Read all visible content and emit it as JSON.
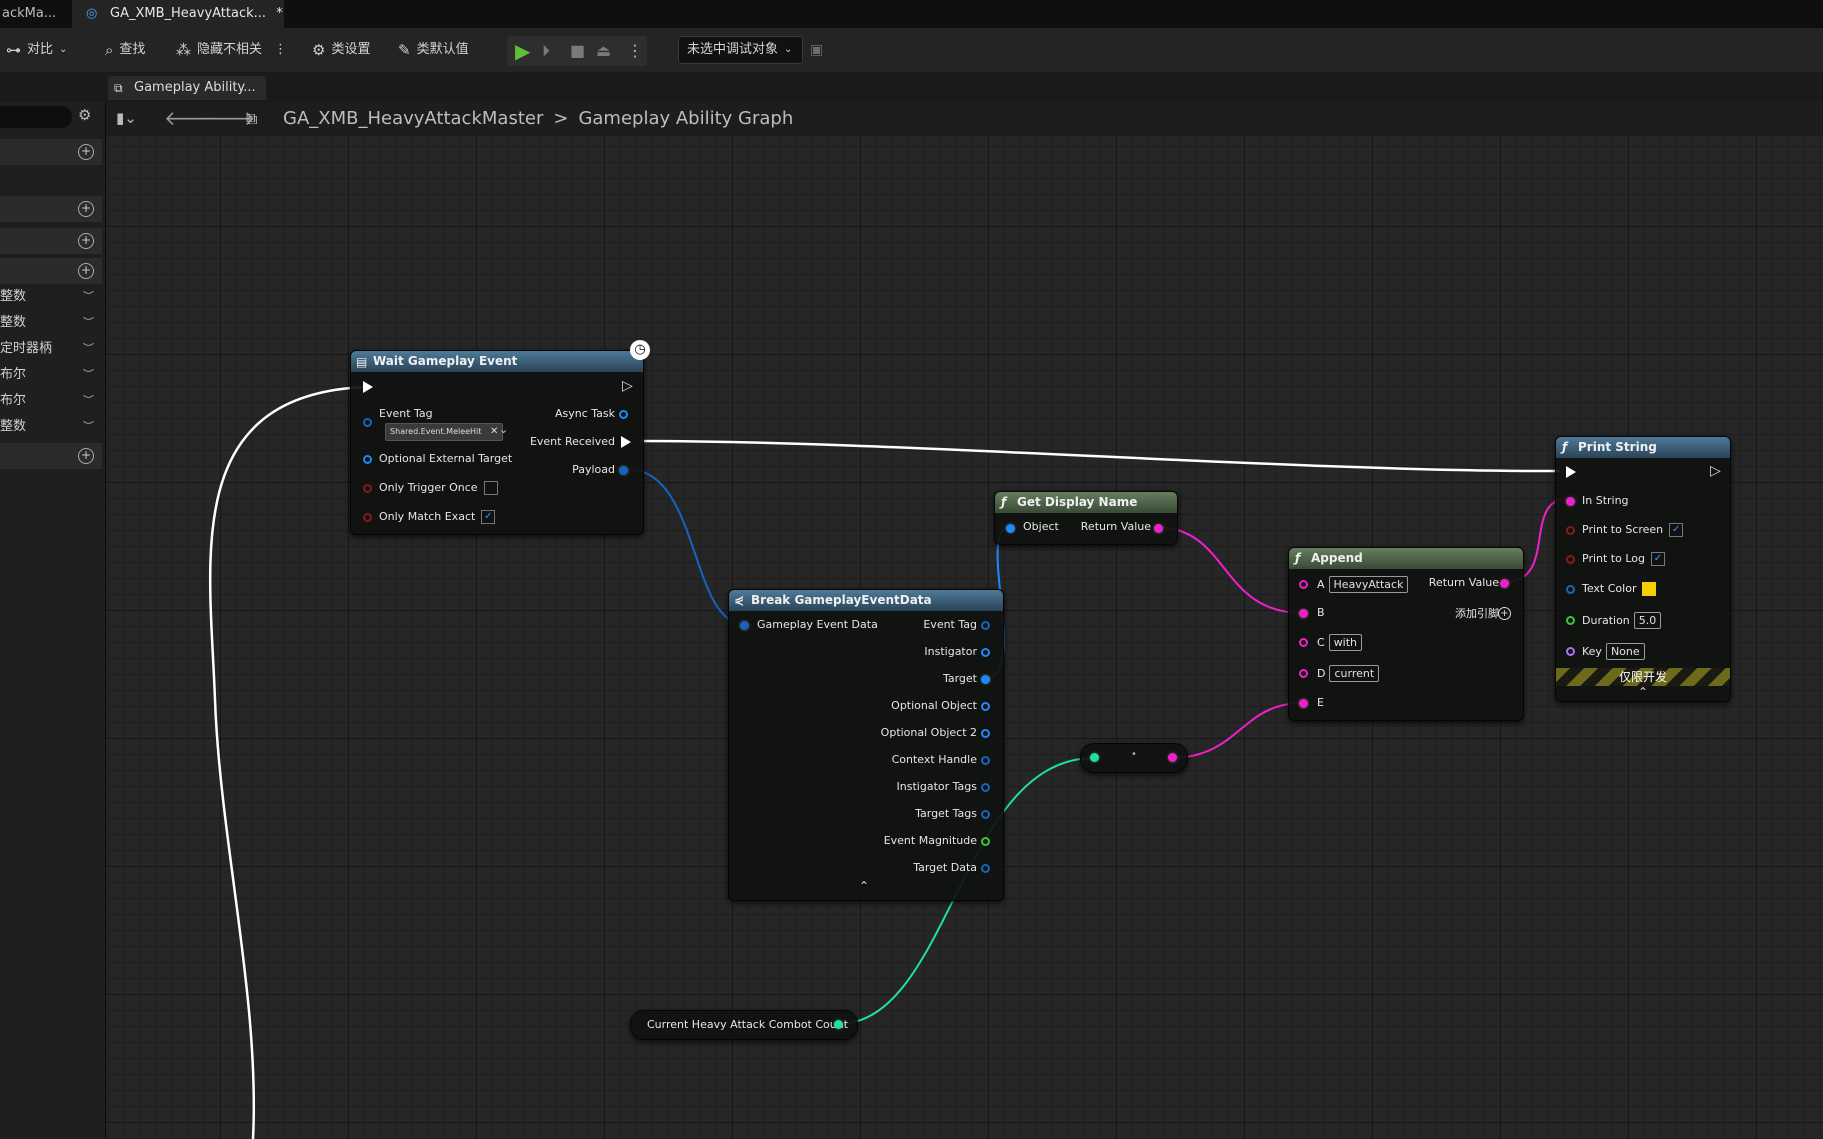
{
  "tabs": {
    "previous": "ackMa...",
    "active": "GA_XMB_HeavyAttack...",
    "active_modified": "*",
    "close": "×"
  },
  "toolbar": {
    "diff": "对比",
    "find": "查找",
    "hide_unrelated": "隐藏不相关",
    "class_settings": "类设置",
    "class_defaults": "类默认值",
    "debug_target": "未选中调试对象"
  },
  "subtab": {
    "label": "Gameplay Ability...",
    "close": "×"
  },
  "breadcrumb": {
    "blueprint": "GA_XMB_HeavyAttackMaster",
    "separator": ">",
    "graph": "Gameplay Ability Graph"
  },
  "left_panel": {
    "variables": [
      {
        "label": "整数"
      },
      {
        "label": "整数"
      },
      {
        "label": "定时器柄"
      },
      {
        "label": "布尔"
      },
      {
        "label": "布尔"
      },
      {
        "label": "整数"
      }
    ]
  },
  "nodes": {
    "wait_event": {
      "title": "Wait Gameplay Event",
      "event_tag": "Event Tag",
      "event_tag_value": "Shared.Event.MeleeHit",
      "optional_external_target": "Optional External Target",
      "only_trigger_once": "Only Trigger Once",
      "only_match_exact": "Only Match Exact",
      "async_task": "Async Task",
      "event_received": "Event Received",
      "payload": "Payload"
    },
    "break_data": {
      "title": "Break GameplayEventData",
      "input": "Gameplay Event Data",
      "outputs": [
        "Event Tag",
        "Instigator",
        "Target",
        "Optional Object",
        "Optional Object 2",
        "Context Handle",
        "Instigator Tags",
        "Target Tags",
        "Event Magnitude",
        "Target Data"
      ]
    },
    "get_display_name": {
      "title": "Get Display Name",
      "object": "Object",
      "return_value": "Return Value"
    },
    "append": {
      "title": "Append",
      "a_label": "A",
      "a_value": "HeavyAttack",
      "b_label": "B",
      "c_label": "C",
      "c_value": "with",
      "d_label": "D",
      "d_value": "current",
      "e_label": "E",
      "return_value": "Return Value",
      "add_pin": "添加引脚"
    },
    "print_string": {
      "title": "Print String",
      "in_string": "In String",
      "print_to_screen": "Print to Screen",
      "print_to_log": "Print to Log",
      "text_color": "Text Color",
      "duration": "Duration",
      "duration_value": "5.0",
      "key": "Key",
      "key_value": "None",
      "dev_only": "仅限开发"
    },
    "variable_getter": {
      "label": "Current Heavy Attack Combot Count"
    }
  },
  "colors": {
    "text_color_swatch": "#f5d000",
    "string_pin": "#f01fcc",
    "object_pin": "#1e88ff",
    "struct_pin": "#1565c0",
    "bool_pin": "#8a1a1a",
    "int_pin": "#1fe0a8",
    "float_pin": "#38c838",
    "name_pin": "#b070ff"
  }
}
